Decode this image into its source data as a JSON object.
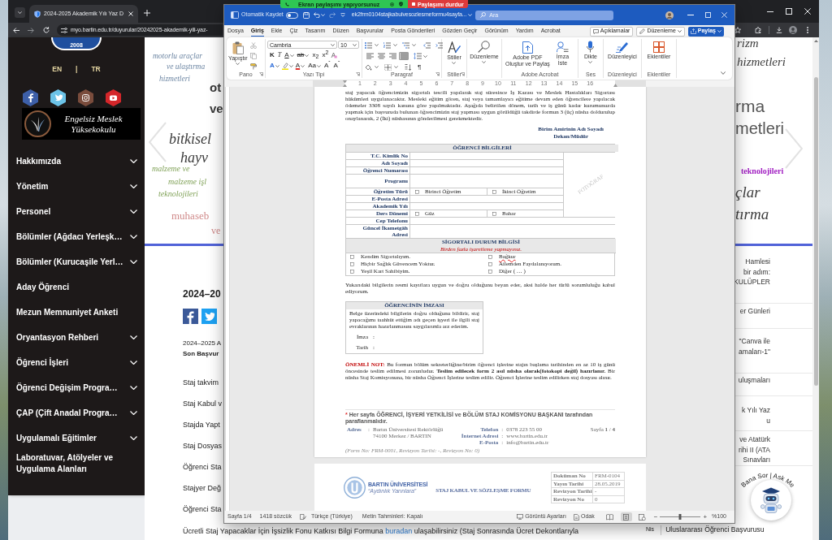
{
  "screen_share": {
    "message": "Ekran paylaşımı yapıyorsunuz",
    "stop_button": "Paylaşımı durdur"
  },
  "browser": {
    "tabs": [
      {
        "title": "2024-2025 Akademik Yılı Yaz D",
        "selected": true
      }
    ],
    "address": "myo.bartin.edu.tr/duyurular/20242025-akademik-yili-yaz-",
    "sidebar": {
      "logo_year": "2008",
      "languages": [
        "EN",
        "TR"
      ],
      "language_separator": "|",
      "school_banner": "Engelsiz Meslek Yüksekokulu",
      "menu": [
        {
          "label": "Hakkımızda",
          "has_submenu": true
        },
        {
          "label": "Yönetim",
          "has_submenu": true
        },
        {
          "label": "Personel",
          "has_submenu": true
        },
        {
          "label": "Bölümler (Ağdacı Yerleşk…",
          "has_submenu": true
        },
        {
          "label": "Bölümler (Kurucaşile Yerl…",
          "has_submenu": true
        },
        {
          "label": "Aday Öğrenci",
          "has_submenu": false
        },
        {
          "label": "Mezun Memnuniyet Anketi",
          "has_submenu": false
        },
        {
          "label": "Oryantasyon Rehberi",
          "has_submenu": true
        },
        {
          "label": "Öğrenci İşleri",
          "has_submenu": true
        },
        {
          "label": "Öğrenci Değişim Progra…",
          "has_submenu": true
        },
        {
          "label": "ÇAP (Çift Anadal Progra…",
          "has_submenu": true
        },
        {
          "label": "Uygulamalı Eğitimler",
          "has_submenu": true
        },
        {
          "label": "Laboratuvar, Atölyeler ve Uygulama Alanları",
          "has_submenu": false
        }
      ]
    },
    "banner_words": [
      {
        "text": "motorlu araçlar",
        "kind": "script-slate"
      },
      {
        "text": "ve ulaştırma",
        "kind": "script-slate"
      },
      {
        "text": "hizmetleri",
        "kind": "script-slate"
      },
      {
        "text": "ot",
        "kind": "bold-sans"
      },
      {
        "text": "ve",
        "kind": "bold-sans"
      },
      {
        "text": "bitkisel",
        "kind": "script-dark"
      },
      {
        "text": "hayv",
        "kind": "script-dark"
      },
      {
        "text": "malzeme ve",
        "kind": "script-green"
      },
      {
        "text": "malzeme işl",
        "kind": "script-green"
      },
      {
        "text": "teknolojileri",
        "kind": "script-green"
      },
      {
        "text": "muhaseb",
        "kind": "serif-rose"
      },
      {
        "text": "ve",
        "kind": "serif-rose"
      },
      {
        "text": "rizm",
        "kind": "script-dark"
      },
      {
        "text": "hizmetleri",
        "kind": "script-dark"
      },
      {
        "text": "rma",
        "kind": "sans-grey"
      },
      {
        "text": "metleri",
        "kind": "sans-grey"
      },
      {
        "text": "teknolojileri",
        "kind": "bold-purple"
      },
      {
        "text": "çlar",
        "kind": "script-dark"
      },
      {
        "text": "tırma",
        "kind": "script-dark"
      }
    ],
    "article": {
      "heading": "2024–20",
      "intro": [
        {
          "text": "2024–2025 A",
          "bold": false
        },
        {
          "text": "Son Başvur",
          "bold": true
        }
      ],
      "links": [
        "Staj takvim",
        "Staj Kabul v",
        "Stajda Yapt",
        "Staj Dosyas",
        "Öğrenci Sta",
        "Stajyer Değ",
        "Öğrenci Sta"
      ],
      "closing": {
        "before": "Ücretli Staj Yapacaklar İçin İşsizlik Fonu Katkısı Bilgi Formuna",
        "link": "buradan",
        "after": "ulaşabilirsiniz (Staj Sonrasında Ücret Dekontlarıyla"
      }
    },
    "news": [
      {
        "lines": [
          "Hamlesi",
          "bir adım:",
          "KULÜPLER"
        ]
      },
      {
        "lines": [
          "er Günleri"
        ]
      },
      {
        "lines": [
          "\"Canva ile",
          "amaları-1\""
        ]
      },
      {
        "lines": [
          "uluşmaları"
        ]
      },
      {
        "lines": [
          "k Yılı Yaz",
          "u"
        ]
      },
      {
        "lines": [
          "ve Atatürk",
          "rihi II (ATA",
          "Sınavları"
        ]
      }
    ],
    "latest_news": {
      "date": "Nis",
      "title": "Uluslararası Öğrenci Başvurusu"
    },
    "chatbot": {
      "label": "Bana Sor | Ask Me"
    }
  },
  "word": {
    "autosave": {
      "label": "Otomatik Kaydet",
      "on": false
    },
    "file_name": "ek2frm0104stajkabulvesozlesmeformu4sayfa...",
    "search": {
      "placeholder": "Ara"
    },
    "menu_tabs": [
      {
        "label": "Dosya",
        "selected": false
      },
      {
        "label": "Giriş",
        "selected": true
      },
      {
        "label": "Ekle",
        "selected": false
      },
      {
        "label": "Çiz",
        "selected": false
      },
      {
        "label": "Tasarım",
        "selected": false
      },
      {
        "label": "Düzen",
        "selected": false
      },
      {
        "label": "Başvurular",
        "selected": false
      },
      {
        "label": "Posta Gönderileri",
        "selected": false
      },
      {
        "label": "Gözden Geçir",
        "selected": false
      },
      {
        "label": "Görünüm",
        "selected": false
      },
      {
        "label": "Yardım",
        "selected": false
      },
      {
        "label": "Acrobat",
        "selected": false
      }
    ],
    "actions": [
      {
        "label": "Açıklamalar",
        "kind": "comments"
      },
      {
        "label": "Düzenleme",
        "kind": "editing"
      },
      {
        "label": "Paylaş",
        "kind": "share"
      }
    ],
    "ribbon": {
      "paste": "Yapıştır",
      "font_name": "Cambria",
      "font_size": "10",
      "format_row_1": [
        {
          "glyph": "K",
          "kind": "bold"
        },
        {
          "glyph": "T",
          "kind": "italic"
        },
        {
          "glyph": "A",
          "kind": "underline"
        },
        {
          "glyph": "ab",
          "kind": "strike"
        },
        {
          "glyph": "x$_{2}$",
          "kind": "subscript"
        },
        {
          "glyph": "x$^{2}$",
          "kind": "superscript"
        }
      ],
      "format_row_2": [
        {
          "glyph": "A",
          "kind": "effects"
        },
        {
          "glyph": "A",
          "kind": "color"
        },
        {
          "glyph": "Aa",
          "kind": "case"
        },
        {
          "glyph": "A$^{ˆ}$",
          "kind": "grow"
        },
        {
          "glyph": "A$^{ˇ}$",
          "kind": "shrink"
        }
      ],
      "alignments": [
        {
          "selected": false
        },
        {
          "selected": false
        },
        {
          "selected": false
        },
        {
          "selected": true
        }
      ],
      "show_marks": "¶",
      "styles": "Stiller",
      "find": "Düzenleme",
      "pdf": [
        "Adobe PDF",
        "Oluştur ve Paylaş"
      ],
      "sign": [
        "İmza",
        "İste"
      ],
      "dictate": "Dikte",
      "editor": "Düzenleyici",
      "addins": "Eklentiler",
      "groups": [
        "Pano",
        "Yazı Tipi",
        "Paragraf",
        "Stiller",
        "Adobe Acrobat",
        "Ses",
        "Düzenleyici",
        "Eklentiler"
      ]
    },
    "ruler": [
      "1",
      "2",
      "3",
      "4",
      "5",
      "6",
      "7",
      "8",
      "9",
      "10",
      "11",
      "12",
      "13",
      "14",
      "15",
      "16"
    ],
    "document": {
      "page_1": {
        "paragraph": "staj yapacak öğrencimizin sigortalı tescili yapılarak staj süresince İş Kazası ve Meslek Hastalıkları Sigortası hükümleri uygulanacaktır. Mesleki eğitim gören, staj veya tamamlayıcı eğitime devam eden öğrencilere yapılacak ödemeler 3308 sayılı kanuna göre yapılmaktadır. Aşağıda belirtilen dönem, tarih ve iş günü kadar kurumunuzda yapmak için başvuruda bulunan öğrencimizin staj yapması uygun görüldüğü takdirde formun 3 (üç) nüsha doldurulup onaylanarak, 2 (İki) nüshasının gönderilmesi gerekmektedir.",
        "signatory": [
          "Birim Amirinin Adı Soyadı",
          "Dekan/Müdür"
        ],
        "student_table": {
          "title": "ÖĞRENCİ BİLGİLERİ",
          "photo_label": "FOTOĞRAF",
          "rows": [
            {
              "label": "T.C. Kimlik No",
              "kind": "blank"
            },
            {
              "label": "Adı Soyadı",
              "kind": "blank"
            },
            {
              "label": "Öğrenci Numarası",
              "kind": "blank"
            },
            {
              "label": "Programı",
              "kind": "tall"
            },
            {
              "label": "Öğretim Türü",
              "kind": "choice",
              "options": [
                {
                  "label": "Birinci Öğretim",
                  "checked": false
                },
                {
                  "label": "İkinci Öğretim",
                  "checked": false
                }
              ]
            },
            {
              "label": "E-Posta Adresi",
              "kind": "blank"
            },
            {
              "label": "Akademik Yılı",
              "kind": "blank"
            },
            {
              "label": "Ders Dönemi",
              "kind": "choice",
              "options": [
                {
                  "label": "Güz",
                  "checked": false
                },
                {
                  "label": "Bahar",
                  "checked": false
                }
              ]
            },
            {
              "label": "Cep Telefonu",
              "kind": "blank"
            },
            {
              "label": "Güncel İkametgâh Adresi",
              "kind": "tall"
            }
          ]
        },
        "insurance": {
          "title": "SİGORTALI DURUM BİLGİSİ",
          "note": "Birden fazla işaretleme yapmayınız.",
          "options": [
            {
              "label": "Kendim Sigortalıyım.",
              "checked": false,
              "misspelled": false
            },
            {
              "label": "Bağkur",
              "checked": false,
              "misspelled": true
            },
            {
              "label": "Hiçbir Sağlık Güvencem Yoktur.",
              "checked": false,
              "misspelled": false
            },
            {
              "label": "Ailemden Faydalanıyorum.",
              "checked": false,
              "misspelled": false
            },
            {
              "label": "Yeşil Kart Sahibiyim.",
              "checked": false,
              "misspelled": false
            },
            {
              "label": "Diğer ( … )",
              "checked": false,
              "misspelled": false
            }
          ]
        },
        "declaration": "Yukarıdaki bilgilerin resmi kayıtlara uygun ve doğru olduğunu beyan eder, aksi halde her türlü sorumluluğu kabul ediyorum.",
        "signature_box": {
          "title": "ÖĞRENCİNİN İMZASI",
          "text": "Belge üzerindeki bilgilerin doğru olduğunu bildirir, staj yapacağımı taahhüt ettiğim adı geçen işyeri ile ilgili staj evraklarının hazırlanmasını saygılarımla arz ederim.",
          "fields": [
            {
              "label": "İmza",
              "colon": ":"
            },
            {
              "label": "Tarih",
              "colon": ":"
            }
          ]
        },
        "important_note": {
          "label": "ÖNEMLİ NOT:",
          "text": "Bu formun bölüm sekreterliğine/birim öğrenci işlerine stajın başlama tarihinden en az 10 iş günü öncesinde teslim edilmesi zorunludur. **Teslim edilecek form 2 asıl nüsha olarak(fotokopi değil) hazırlanır.** Bir nüsha Staj Komisyonuna, bir nüsha Öğrenci İşlerine teslim edilir. Öğrenci İşlerine teslim edilirken staj dosyası alınır."
        },
        "footer": {
          "note_mark": "*",
          "note": "Her sayfa ÖĞRENCİ, İŞYERİ YETKİLİSİ ve BÖLÜM STAJ KOMİSYONU BAŞKANI tarafından paraflanmalıdır.",
          "contacts": [
            {
              "label": "Adres",
              "colon": ":",
              "lines": [
                "Bartın Üniversitesi Rektörlüğü",
                "74100 Merkez / BARTIN"
              ]
            },
            {
              "label": "Telefon",
              "colon": ":",
              "lines": [
                "0378 223 55 00"
              ]
            },
            {
              "label": "İnternet Adresi",
              "colon": ":",
              "lines": [
                "www.bartin.edu.tr"
              ]
            },
            {
              "label": "E-Posta",
              "colon": ":",
              "lines": [
                "info@bartin.edu.tr"
              ]
            }
          ],
          "page_number": "Sayfa **1** / **4**",
          "form_info": "(Form No: FRM-0001, Revizyon Tarihi: -, Revizyon No: 0)"
        }
      },
      "page_2": {
        "university": "BARTIN ÜNİVERSİTESİ",
        "motto": "“Aydınlık Yarınlara”",
        "form_title": "STAJ KABUL VE SÖZLEŞME FORMU",
        "doc_info": [
          {
            "label": "Doküman No",
            "value": "FRM-0104"
          },
          {
            "label": "Yayın Tarihi",
            "value": "28.05.2019"
          },
          {
            "label": "Revizyon Tarihi",
            "value": "-"
          },
          {
            "label": "Revizyon No",
            "value": "0"
          }
        ]
      }
    },
    "status_bar": {
      "page": "Sayfa 1/4",
      "words": "1418 sözcük",
      "language": "Türkçe (Türkiye)",
      "predictions": "Metin Tahminleri: Kapalı",
      "display": "Görüntü Ayarları",
      "focus": "Odak",
      "views": [
        {
          "selected": false
        },
        {
          "selected": true
        },
        {
          "selected": false
        }
      ],
      "zoom_minus": "−",
      "zoom_plus": "+",
      "zoom": {
        "level": 0.5,
        "reading": "%100"
      }
    }
  }
}
